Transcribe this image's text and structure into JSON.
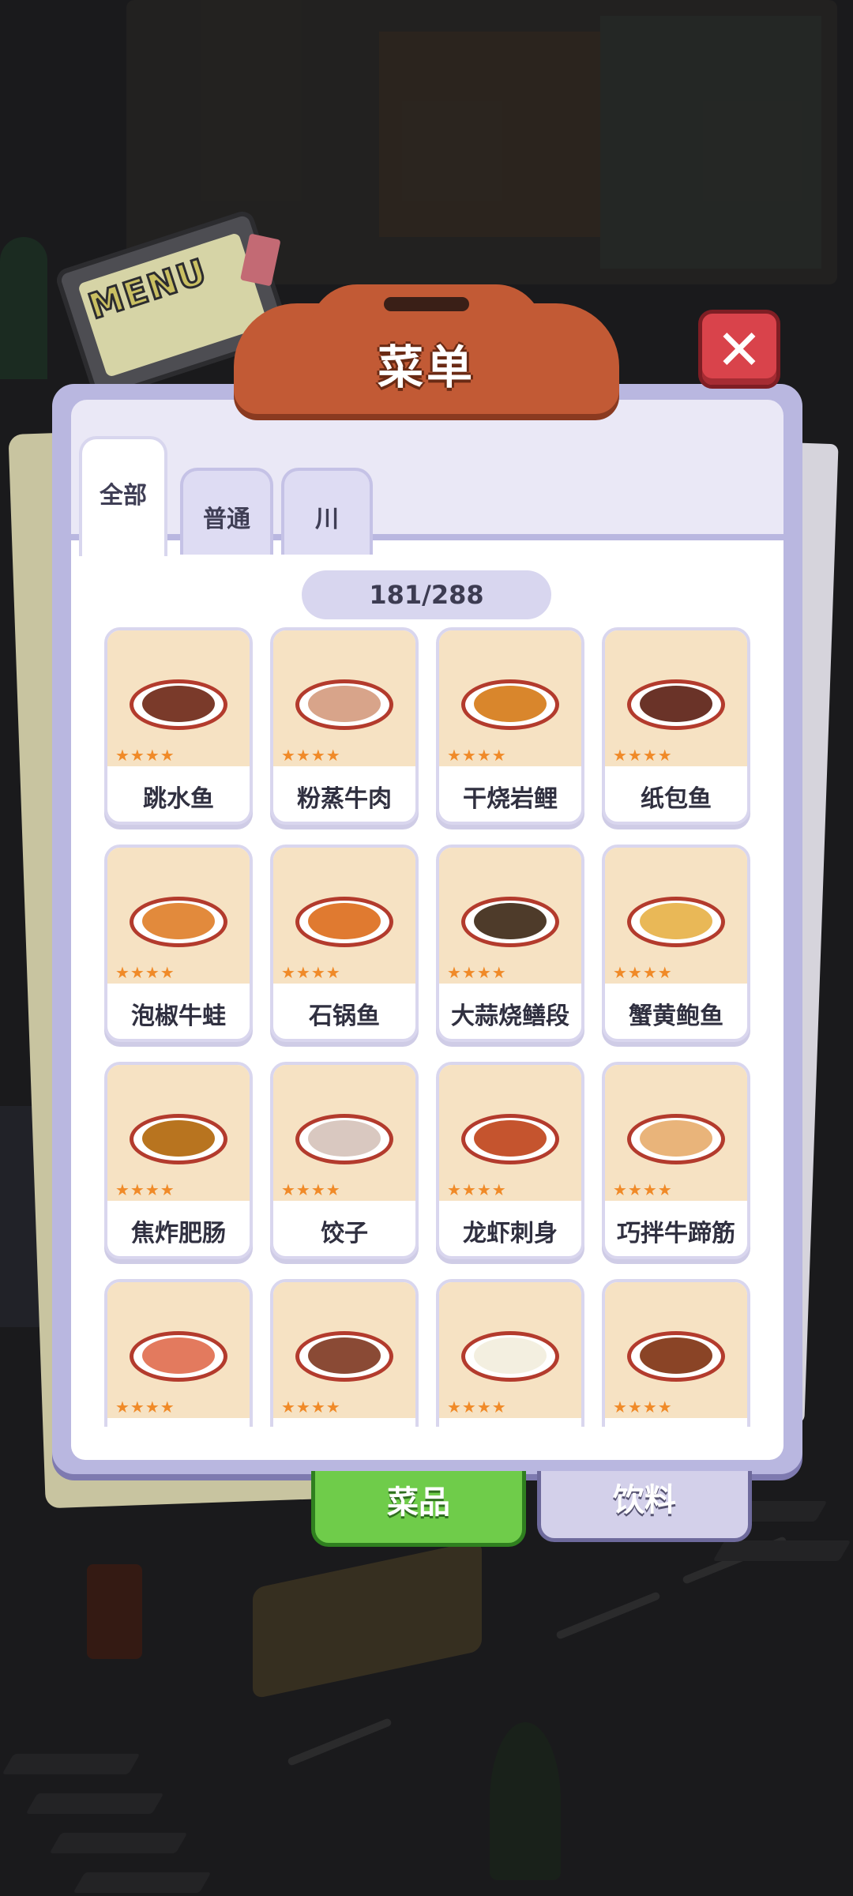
{
  "menu_sign": {
    "label": "MENU"
  },
  "header": {
    "title": "菜单"
  },
  "close_button": {
    "label": "✕"
  },
  "tabs": [
    {
      "label": "全部",
      "active": true
    },
    {
      "label": "普通",
      "active": false
    },
    {
      "label": "川",
      "active": false
    }
  ],
  "counter": "181/288",
  "dishes": [
    {
      "name": "跳水鱼",
      "stars": "★★★★",
      "food_color": "#7a3a2a"
    },
    {
      "name": "粉蒸牛肉",
      "stars": "★★★★",
      "food_color": "#d8a48a"
    },
    {
      "name": "干烧岩鲤",
      "stars": "★★★★",
      "food_color": "#d9862c"
    },
    {
      "name": "纸包鱼",
      "stars": "★★★★",
      "food_color": "#6a3328"
    },
    {
      "name": "泡椒牛蛙",
      "stars": "★★★★",
      "food_color": "#e28a3c"
    },
    {
      "name": "石锅鱼",
      "stars": "★★★★",
      "food_color": "#e07a30"
    },
    {
      "name": "大蒜烧鳝段",
      "stars": "★★★★",
      "food_color": "#4e3b2a"
    },
    {
      "name": "蟹黄鲍鱼",
      "stars": "★★★★",
      "food_color": "#e9b857"
    },
    {
      "name": "焦炸肥肠",
      "stars": "★★★★",
      "food_color": "#b8741f"
    },
    {
      "name": "饺子",
      "stars": "★★★★",
      "food_color": "#d9c8c0"
    },
    {
      "name": "龙虾刺身",
      "stars": "★★★★",
      "food_color": "#c5542e"
    },
    {
      "name": "巧拌牛蹄筋",
      "stars": "★★★★",
      "food_color": "#e9b47a"
    },
    {
      "name": "",
      "stars": "★★★★",
      "food_color": "#e37a5e"
    },
    {
      "name": "",
      "stars": "★★★★",
      "food_color": "#8a4a35"
    },
    {
      "name": "",
      "stars": "★★★★",
      "food_color": "#f3efe0"
    },
    {
      "name": "",
      "stars": "★★★★",
      "food_color": "#8a4426"
    }
  ],
  "bottom_tabs": {
    "dishes": "菜品",
    "drinks": "饮料"
  }
}
